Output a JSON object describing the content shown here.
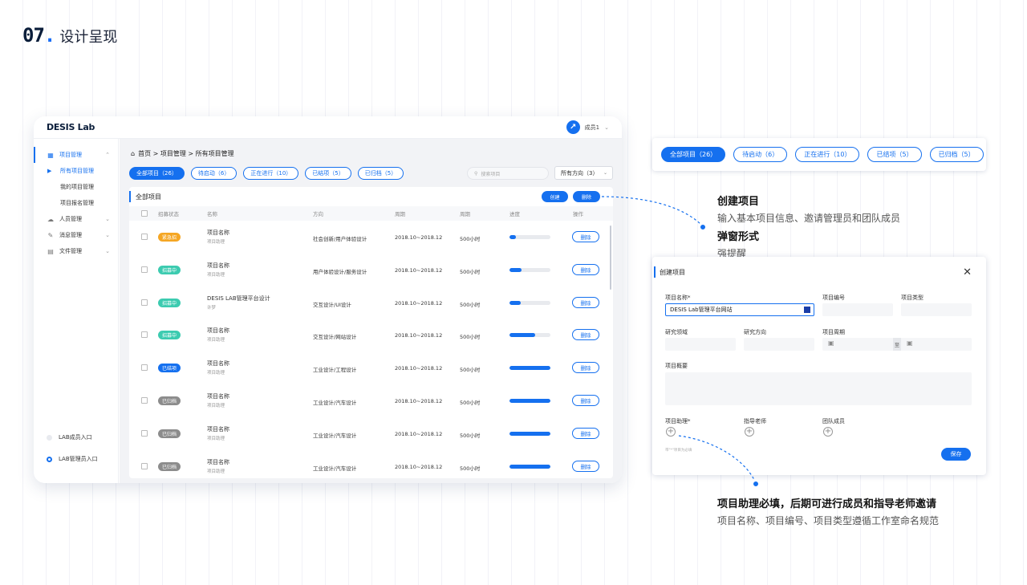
{
  "heading": {
    "number": "07",
    "title": "设计呈现"
  },
  "app": {
    "brand": "DESIS Lab",
    "user": "成员1",
    "breadcrumb": "首页 > 项目管理 > 所有项目管理",
    "sidebar": {
      "groups": [
        {
          "label": "项目管理",
          "icon": "grid-icon",
          "active": true
        },
        {
          "label": "人员管理",
          "icon": "people-icon"
        },
        {
          "label": "消息管理",
          "icon": "megaphone-icon"
        },
        {
          "label": "文件管理",
          "icon": "file-icon"
        }
      ],
      "sub_items": [
        "所有项目管理",
        "我的项目管理",
        "项目报名管理"
      ],
      "entries": [
        "LAB成员入口",
        "LAB管理员入口"
      ]
    },
    "filters": [
      "全部项目（26）",
      "待启动（6）",
      "正在进行（10）",
      "已结项（5）",
      "已归档（5）"
    ],
    "search_placeholder": "搜索项目",
    "direction_select": "所有方向（3）",
    "card_title": "全部项目",
    "create_label": "创建",
    "delete_label": "删除",
    "columns": [
      "招募状态",
      "名称",
      "方向",
      "周期",
      "周期",
      "进度",
      "操作"
    ],
    "rows": [
      {
        "status": "紧急招",
        "status_color": "#f5a623",
        "name": "项目名称",
        "sub": "项目助理",
        "direction": "社会创新/用户体验设计",
        "period": "2018.10~2018.12",
        "hours": "500小时",
        "progress": 0.15
      },
      {
        "status": "招募中",
        "status_color": "#3ccbb0",
        "name": "项目名称",
        "sub": "项目助理",
        "direction": "用户体验设计/服务设计",
        "period": "2018.10~2018.12",
        "hours": "500小时",
        "progress": 0.3
      },
      {
        "status": "招募中",
        "status_color": "#3ccbb0",
        "name": "DESIS LAB管理平台设计",
        "sub": "许梦",
        "direction": "交互设计/UI设计",
        "period": "2018.10~2018.12",
        "hours": "500小时",
        "progress": 0.27
      },
      {
        "status": "招募中",
        "status_color": "#3ccbb0",
        "name": "项目名称",
        "sub": "项目助理",
        "direction": "交互设计/网站设计",
        "period": "2018.10~2018.12",
        "hours": "500小时",
        "progress": 0.63
      },
      {
        "status": "已结项",
        "status_color": "#1570ef",
        "name": "项目名称",
        "sub": "项目助理",
        "direction": "工业设计/工程设计",
        "period": "2018.10~2018.12",
        "hours": "500小时",
        "progress": 1.0
      },
      {
        "status": "已归档",
        "status_color": "#8c8c8c",
        "name": "项目名称",
        "sub": "项目助理",
        "direction": "工业设计/汽车设计",
        "period": "2018.10~2018.12",
        "hours": "500小时",
        "progress": 1.0
      },
      {
        "status": "已归档",
        "status_color": "#8c8c8c",
        "name": "项目名称",
        "sub": "项目助理",
        "direction": "工业设计/汽车设计",
        "period": "2018.10~2018.12",
        "hours": "500小时",
        "progress": 1.0
      },
      {
        "status": "已归档",
        "status_color": "#8c8c8c",
        "name": "项目名称",
        "sub": "项目助理",
        "direction": "工业设计/汽车设计",
        "period": "2018.10~2018.12",
        "hours": "500小时",
        "progress": 1.0
      }
    ]
  },
  "filter_strip": [
    "全部项目（26）",
    "待启动（6）",
    "正在进行（10）",
    "已结项（5）",
    "已归档（5）"
  ],
  "note_create": {
    "title": "创建项目",
    "desc": "输入基本项目信息、邀请管理员和团队成员",
    "title2": "弹窗形式",
    "desc2": "强提醒"
  },
  "modal": {
    "title": "创建项目",
    "close": "✕",
    "labels": {
      "name": "项目名称*",
      "code": "项目编号",
      "type": "项目类型",
      "field": "研究领域",
      "direction": "研究方向",
      "period": "项目周期",
      "summary": "项目概要",
      "assistant": "项目助理*",
      "advisor": "指导老师",
      "team": "团队成员"
    },
    "name_value": "DESIS Lab管理平台网站",
    "period_to": "至",
    "hint": "带\"*\"项目为必填",
    "save": "保存"
  },
  "note_assistant": {
    "title": "项目助理必填，后期可进行成员和指导老师邀请",
    "desc": "项目名称、项目编号、项目类型遵循工作室命名规范"
  },
  "colors": {
    "accent": "#1570ef"
  }
}
